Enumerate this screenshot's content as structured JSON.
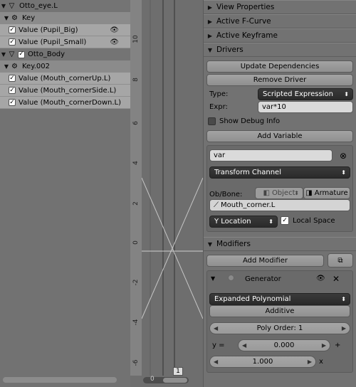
{
  "channels": {
    "rows": [
      {
        "type": "object",
        "label": "Otto_eye.L",
        "expanded": true
      },
      {
        "type": "group",
        "label": "Key",
        "expanded": true
      },
      {
        "type": "channel",
        "label": "Value (Pupil_Big)",
        "checked": true,
        "visible": true
      },
      {
        "type": "channel",
        "label": "Value (Pupil_Small)",
        "checked": true,
        "visible": true
      },
      {
        "type": "object",
        "label": "Otto_Body",
        "expanded": true,
        "checked": true
      },
      {
        "type": "group",
        "label": "Key.002",
        "expanded": true
      },
      {
        "type": "channel",
        "label": "Value (Mouth_cornerUp.L)",
        "checked": true,
        "selected": true
      },
      {
        "type": "channel",
        "label": "Value (Mouth_cornerSide.L)",
        "checked": true,
        "selected": true
      },
      {
        "type": "channel",
        "label": "Value (Mouth_cornerDown.L)",
        "checked": true,
        "selected": true
      }
    ]
  },
  "graph": {
    "y_ticks": [
      "10",
      "8",
      "6",
      "4",
      "2",
      "0",
      "-2",
      "-4",
      "-6"
    ],
    "current_frame": "1",
    "scroll_label": "0"
  },
  "props": {
    "panels": {
      "view_properties": "View Properties",
      "active_fcurve": "Active F-Curve",
      "active_keyframe": "Active Keyframe",
      "drivers": "Drivers",
      "modifiers": "Modifiers"
    },
    "drivers": {
      "update_dependencies": "Update Dependencies",
      "remove_driver": "Remove Driver",
      "type_label": "Type:",
      "type_value": "Scripted Expression",
      "expr_label": "Expr:",
      "expr_value": "var*10",
      "show_debug_label": "Show Debug Info",
      "show_debug_checked": false,
      "add_variable": "Add Variable",
      "variable": {
        "name": "var",
        "type": "Transform Channel",
        "ob_bone_label": "Ob/Bone:",
        "object_tab": "Object",
        "armature_tab": "Armature",
        "bone": "Mouth_corner.L",
        "channel": "Y Location",
        "local_space_label": "Local Space",
        "local_space_checked": true
      }
    },
    "modifiers": {
      "add_modifier": "Add Modifier",
      "generator": {
        "name": "Generator",
        "mode": "Expanded Polynomial",
        "additive": "Additive",
        "poly_order": "Poly Order: 1",
        "y_label": "y =",
        "coef0": "0.000",
        "plus": "+",
        "coef1": "1.000",
        "x": "x"
      }
    }
  }
}
